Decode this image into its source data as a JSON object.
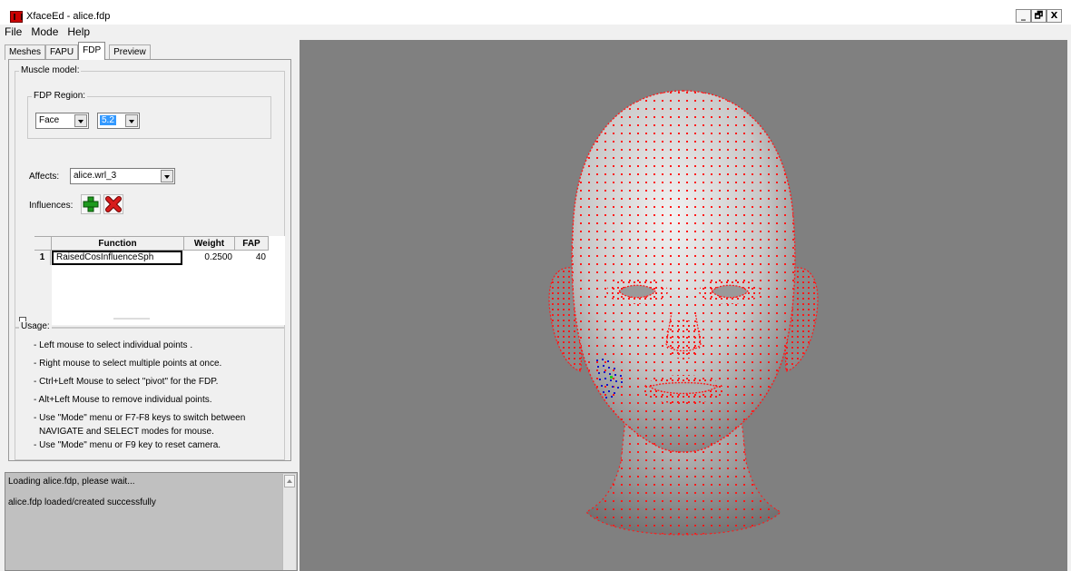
{
  "window": {
    "title": "XfaceEd - alice.fdp",
    "controls": [
      "_",
      "🗗",
      "X"
    ]
  },
  "menu": [
    "File",
    "Mode",
    "Help"
  ],
  "tabs": [
    "Meshes",
    "FAPU",
    "FDP",
    "Preview"
  ],
  "active_tab": "FDP",
  "muscle_model": {
    "legend": "Muscle model:",
    "fdp_region_legend": "FDP Region:",
    "region_value": "Face",
    "point_value": "5.2",
    "affects_label": "Affects:",
    "affects_value": "alice.wrl_3",
    "influences_label": "Influences:",
    "add_icon": "green-plus-icon",
    "remove_icon": "red-x-icon"
  },
  "influences_table": {
    "columns": [
      "Function",
      "Weight",
      "FAP"
    ],
    "rows": [
      {
        "num": "1",
        "function": "RaisedCosInfluenceSph",
        "weight": "0.2500",
        "fap": "40"
      }
    ]
  },
  "usage": {
    "legend": "Usage:",
    "lines": [
      "- Left mouse to select individual points .",
      "- Right mouse to select multiple points at once.",
      "- Ctrl+Left Mouse to select \"pivot\" for the FDP.",
      "- Alt+Left Mouse to remove individual points.",
      "- Use \"Mode\" menu or F7-F8 keys to switch between",
      "NAVIGATE and SELECT modes for mouse.",
      "- Use \"Mode\" menu or F9 key to reset camera."
    ]
  },
  "log": {
    "lines": [
      "Loading alice.fdp, please wait...",
      "alice.fdp loaded/created successfully"
    ]
  },
  "colors": {
    "viewport_bg": "#808080",
    "mesh_points": "#ff0000",
    "selected_points": "#0000cc"
  }
}
